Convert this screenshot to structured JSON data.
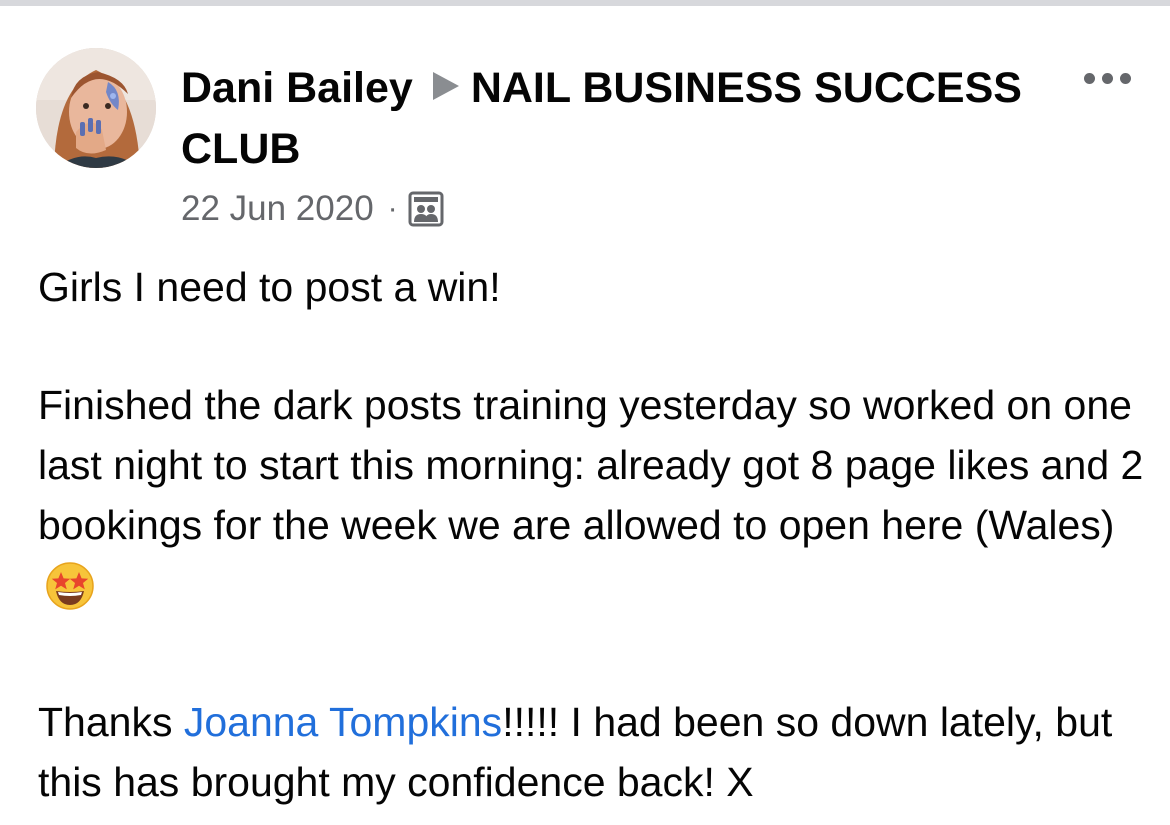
{
  "post": {
    "author": "Dani Bailey",
    "group": "NAIL BUSINESS SUCCESS CLUB",
    "date": "22 Jun 2020",
    "separator": "·",
    "privacy_icon": "group-members-icon",
    "more_icon": "more-options-icon",
    "paragraph1": "Girls I need to post a win!",
    "paragraph2": "Finished the dark posts training yesterday so worked on one last night to start this morning: already got 8 page likes and 2 bookings for the week we are allowed to open here (Wales)",
    "paragraph2_emoji": "star-struck-emoji",
    "paragraph3_prefix": "Thanks ",
    "mention": "Joanna Tompkins",
    "paragraph3_suffix": "!!!!! I had been so down lately, but this has brought my confidence back! X"
  },
  "colors": {
    "mention": "#216fdb",
    "meta_text": "#65676b",
    "text": "#050505"
  }
}
